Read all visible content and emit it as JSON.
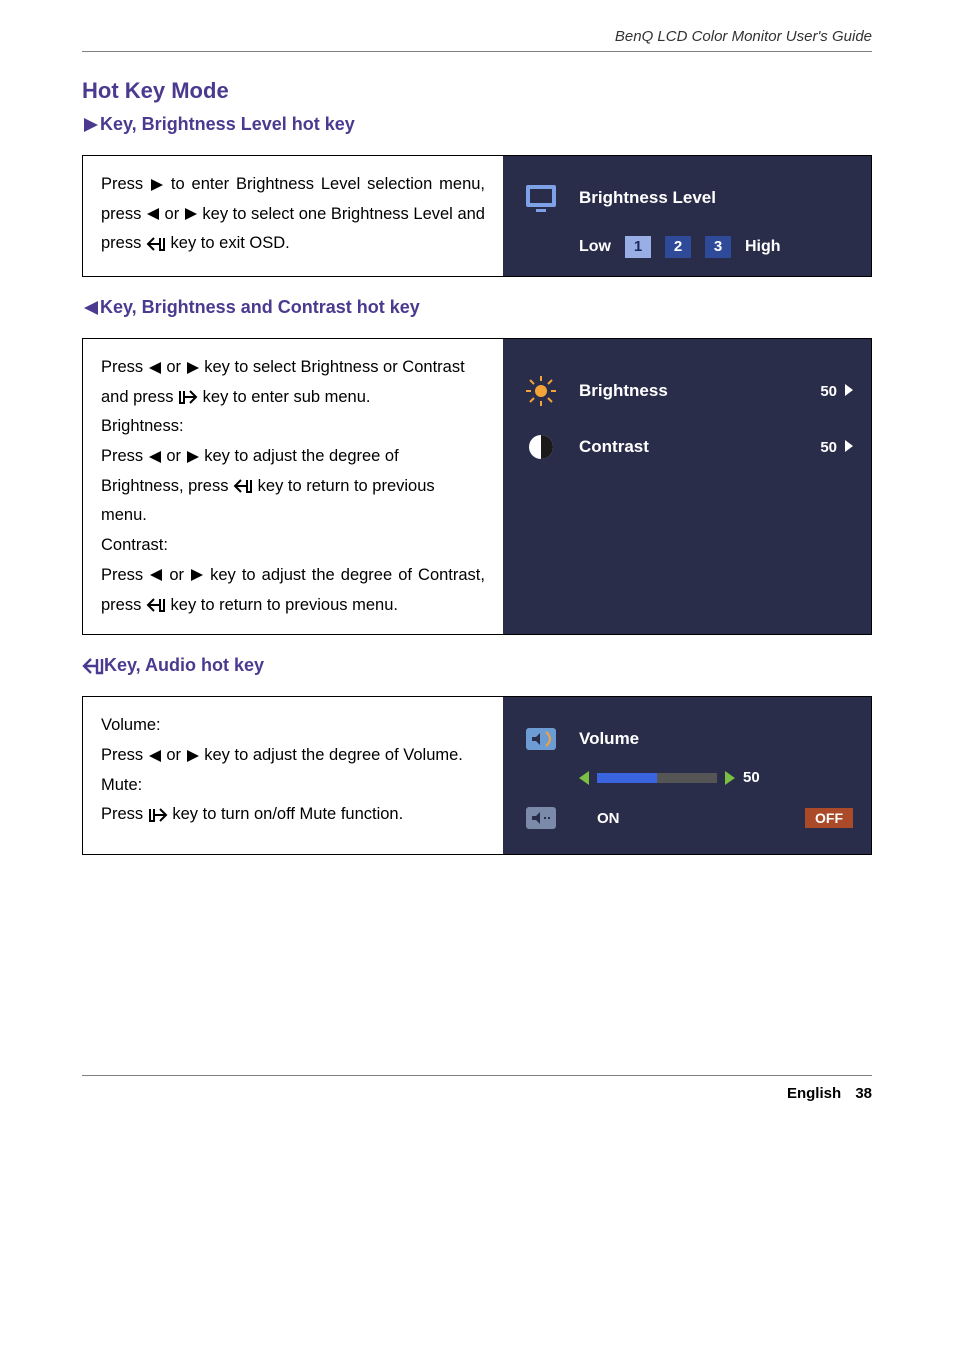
{
  "header": {
    "guide": "BenQ LCD Color Monitor User's Guide"
  },
  "titles": {
    "hotkey": "Hot Key Mode",
    "sec1": " Key, Brightness Level hot key",
    "sec2": " Key, Brightness and Contrast hot key",
    "sec3": " Key, Audio hot key"
  },
  "sec1": {
    "t1": "Press ",
    "t2": " to enter Brightness Level selection menu, press ",
    "t3": " or ",
    "t4": " key to select one Brightness Level and press ",
    "t5": " key to exit OSD."
  },
  "osd1": {
    "label": "Brightness Level",
    "low": "Low",
    "n1": "1",
    "n2": "2",
    "n3": "3",
    "high": "High"
  },
  "sec2": {
    "a1": "Press ",
    "a2": " or ",
    "a3": " key to select Brightness or Contrast and press ",
    "a4": " key to enter sub menu.",
    "b0": "Brightness:",
    "b1": "Press ",
    "b2": " or ",
    "b3": " key to adjust the degree of Brightness, press ",
    "b4": " key to return to previous menu.",
    "c0": "Contrast:",
    "c1": "Press ",
    "c2": " or ",
    "c3": " key to adjust the degree of Contrast, press ",
    "c4": " key to return to previous menu."
  },
  "osd2": {
    "brightness": "Brightness",
    "contrast": "Contrast",
    "bval": "50",
    "cval": "50"
  },
  "sec3": {
    "v0": "Volume:",
    "v1": "Press ",
    "v2": " or ",
    "v3": " key to adjust the degree of Volume.",
    "m0": "Mute:",
    "m1": "Press ",
    "m2": " key to turn on/off Mute function."
  },
  "osd3": {
    "volume": "Volume",
    "vval": "50",
    "on": "ON",
    "off": "OFF"
  },
  "footer": {
    "lang": "English",
    "page": "38"
  },
  "chart_data": {
    "type": "table",
    "title": "OSD Hot Key values",
    "rows": [
      {
        "item": "Brightness Level selected",
        "value": 1,
        "range": "Low / 1 / 2 / 3 / High"
      },
      {
        "item": "Brightness",
        "value": 50,
        "range": "0-100"
      },
      {
        "item": "Contrast",
        "value": 50,
        "range": "0-100"
      },
      {
        "item": "Volume",
        "value": 50,
        "range": "0-100"
      },
      {
        "item": "Mute",
        "value": "OFF",
        "range": "ON / OFF"
      }
    ]
  }
}
